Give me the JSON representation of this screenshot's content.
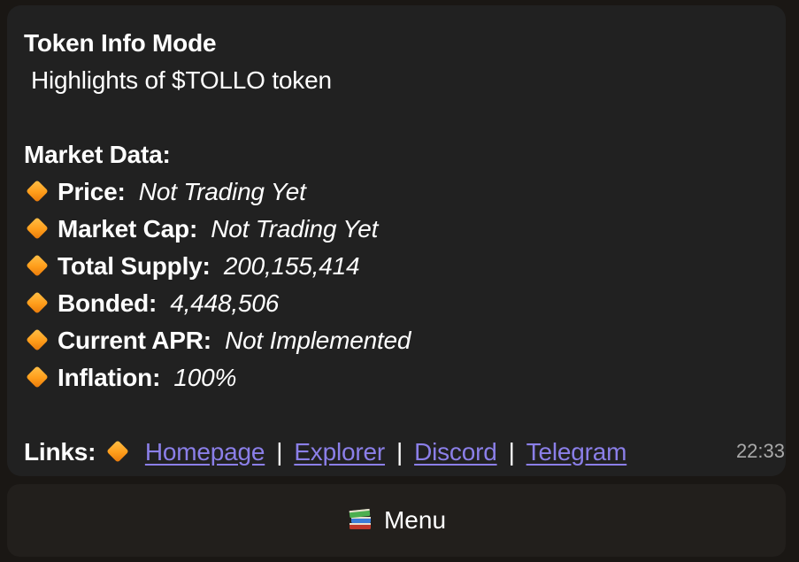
{
  "message": {
    "title": "Token Info Mode",
    "subtitle": "Highlights of $TOLLO token",
    "market_heading": "Market Data:",
    "items": [
      {
        "label": "Price:",
        "value": "Not Trading Yet"
      },
      {
        "label": "Market Cap:",
        "value": "Not Trading Yet"
      },
      {
        "label": "Total Supply:",
        "value": "200,155,414"
      },
      {
        "label": "Bonded:",
        "value": "4,448,506"
      },
      {
        "label": "Current APR:",
        "value": "Not Implemented"
      },
      {
        "label": "Inflation:",
        "value": "100%"
      }
    ],
    "links_label": "Links:",
    "links": [
      "Homepage",
      "Explorer",
      "Discord",
      "Telegram"
    ],
    "separator": "|",
    "time": "22:33"
  },
  "keyboard": {
    "menu_label": "Menu",
    "menu_icon": "books-icon"
  },
  "colors": {
    "background": "#1a1714",
    "bubble": "#212121",
    "link": "#8b7fe8",
    "diamond": "#ff9d1a",
    "time": "#a9a9a9"
  }
}
